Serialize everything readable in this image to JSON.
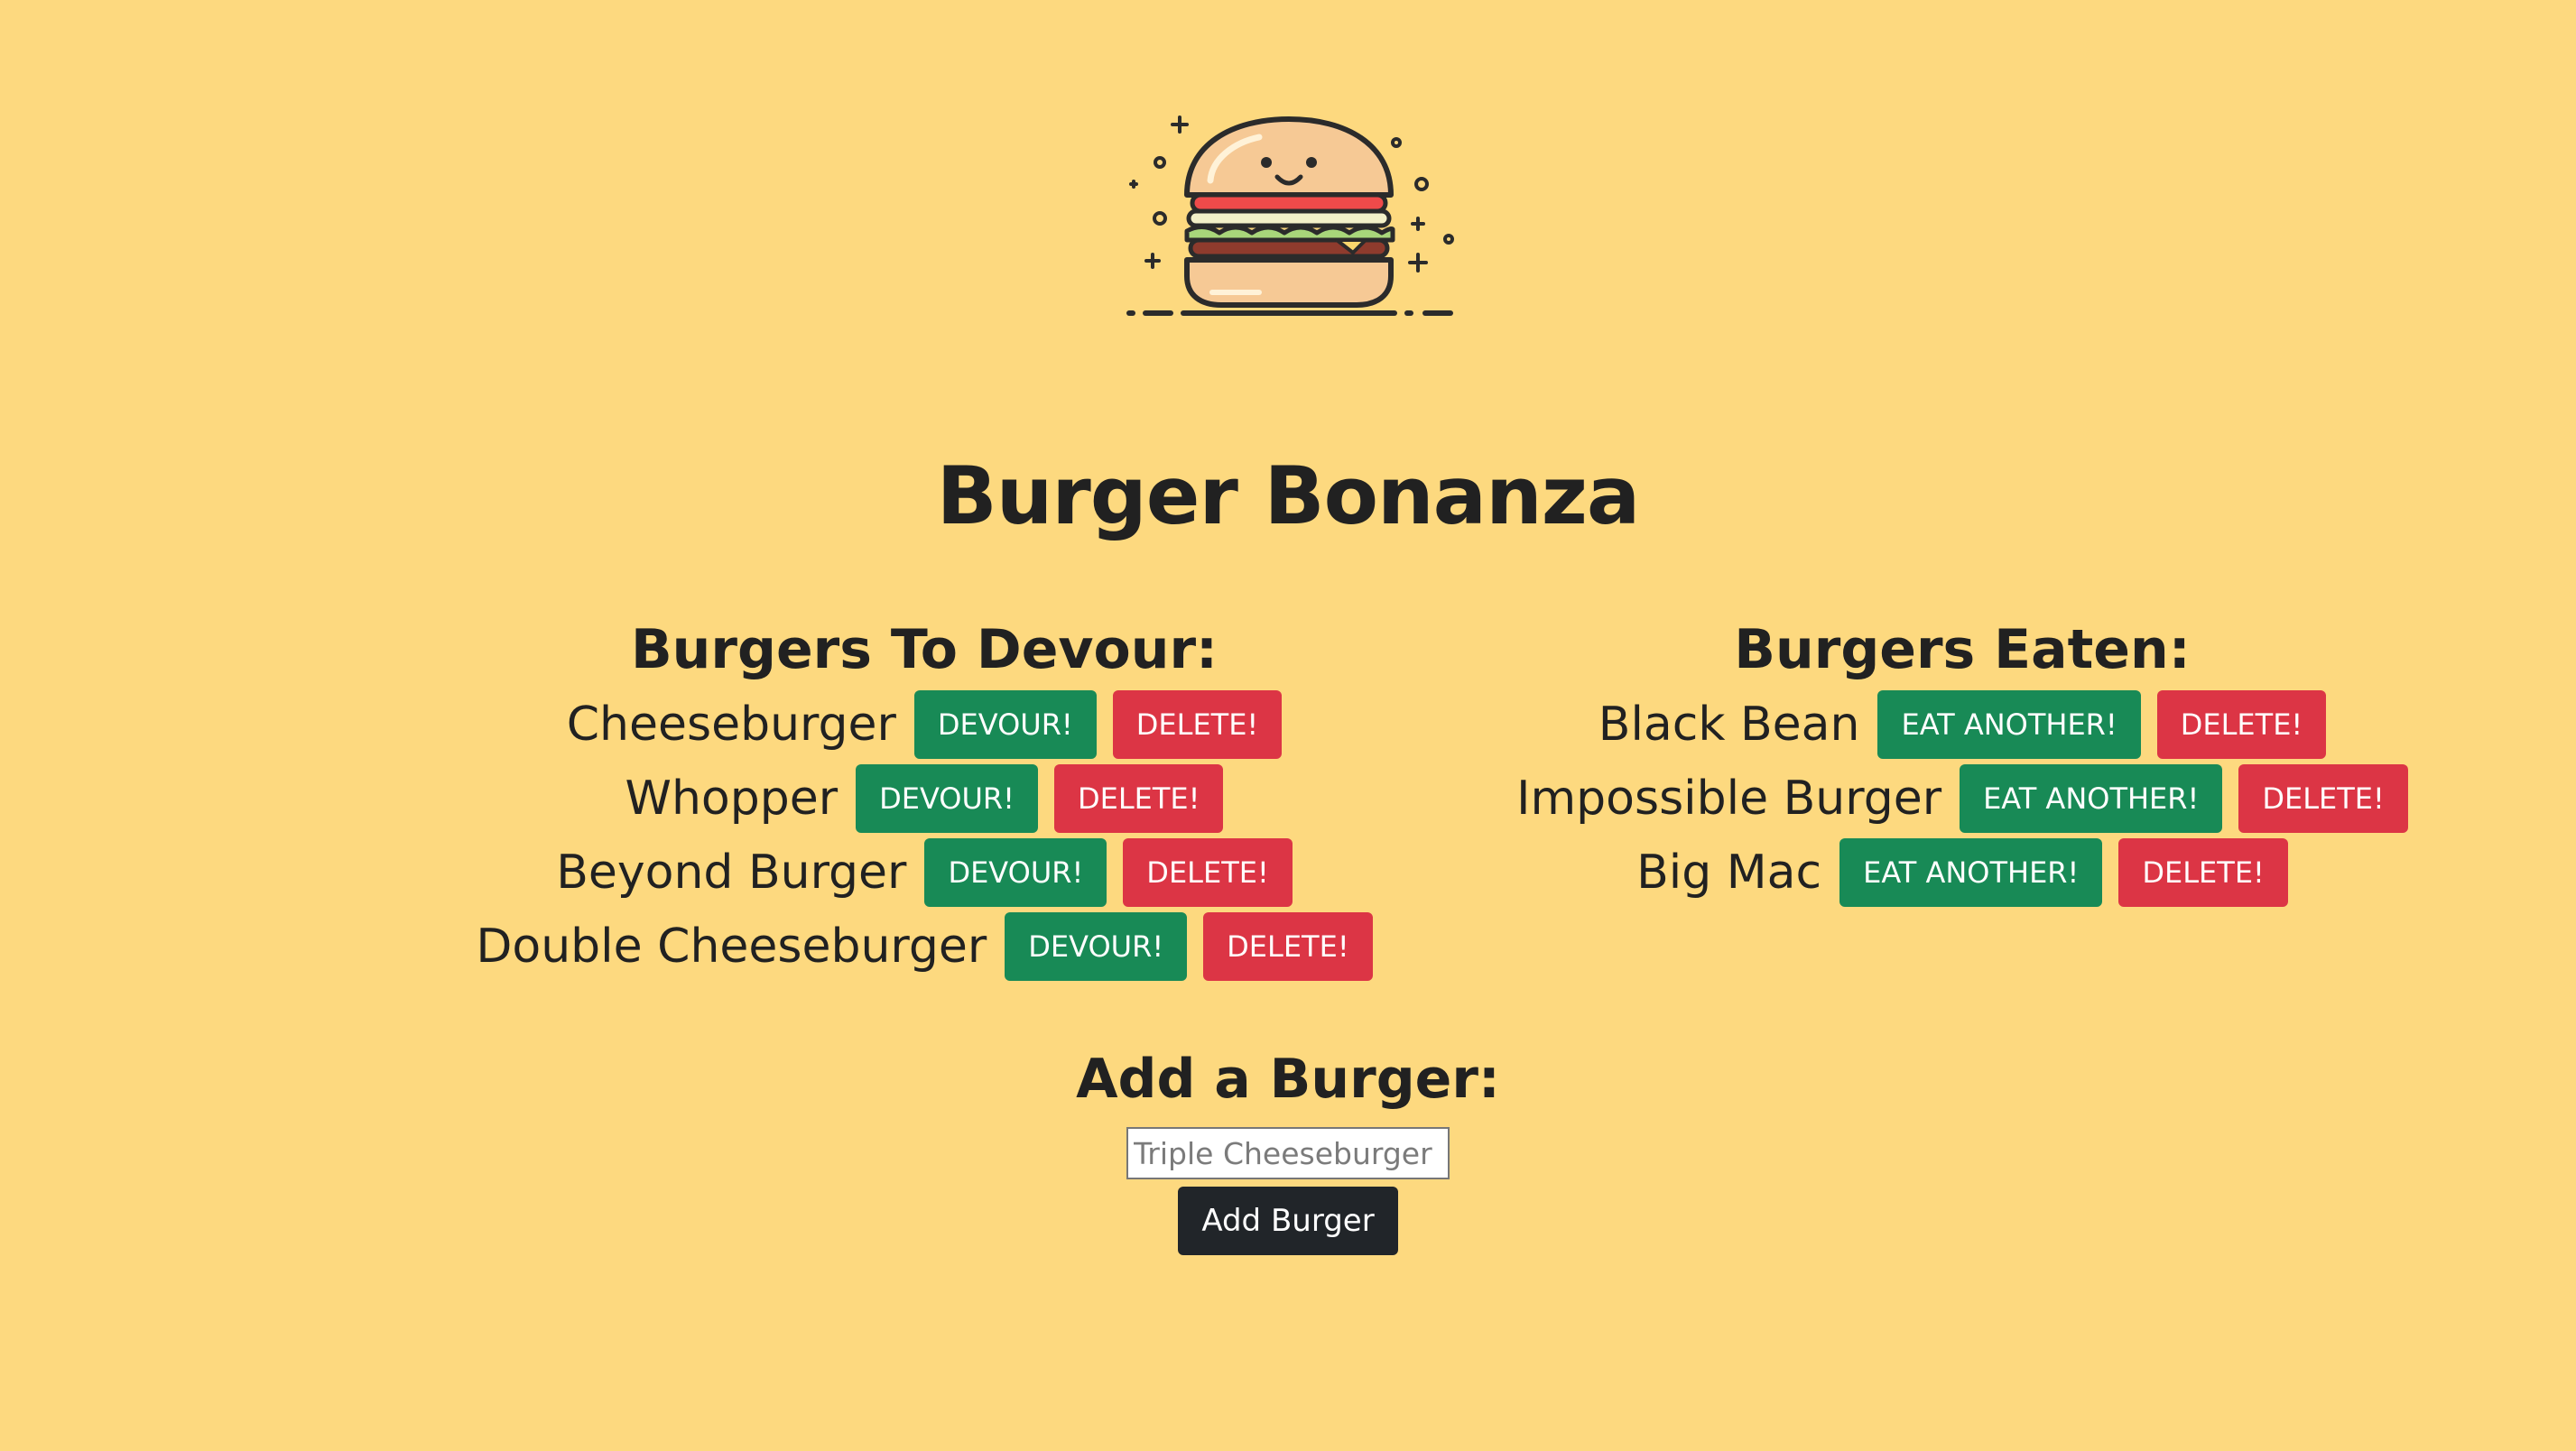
{
  "page": {
    "title": "Burger Bonanza",
    "background_color": "#fdd97f"
  },
  "logo": {
    "icon": "smiling-burger-icon"
  },
  "to_devour": {
    "heading": "Burgers To Devour:",
    "action_label": "DEVOUR!",
    "delete_label": "DELETE!",
    "items": [
      {
        "name": "Cheeseburger"
      },
      {
        "name": "Whopper"
      },
      {
        "name": "Beyond Burger"
      },
      {
        "name": "Double Cheeseburger"
      }
    ]
  },
  "eaten": {
    "heading": "Burgers Eaten:",
    "action_label": "EAT ANOTHER!",
    "delete_label": "DELETE!",
    "items": [
      {
        "name": "Black Bean"
      },
      {
        "name": "Impossible Burger"
      },
      {
        "name": "Big Mac"
      }
    ]
  },
  "add_form": {
    "heading": "Add a Burger:",
    "input_value": "",
    "input_placeholder": "Triple Cheeseburger",
    "submit_label": "Add Burger"
  },
  "colors": {
    "devour_button": "#188a56",
    "delete_button": "#dc3545",
    "submit_button": "#212529"
  }
}
